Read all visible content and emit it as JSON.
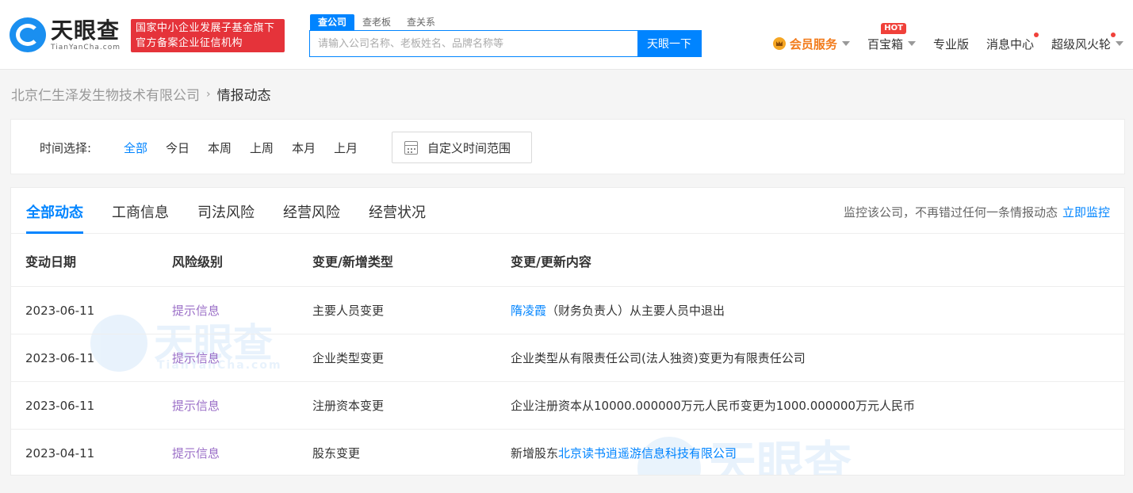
{
  "header": {
    "logo_text": "天眼查",
    "logo_sub": "TianYanCha.com",
    "badge_line1": "国家中小企业发展子基金旗下",
    "badge_line2": "官方备案企业征信机构",
    "search_tabs": [
      "查公司",
      "查老板",
      "查关系"
    ],
    "search_placeholder": "请输入公司名称、老板姓名、品牌名称等",
    "search_button": "天眼一下",
    "nav": {
      "vip": "会员服务",
      "treasure": "百宝箱",
      "hot": "HOT",
      "pro": "专业版",
      "messages": "消息中心",
      "fire": "超级风火轮"
    }
  },
  "breadcrumb": {
    "company": "北京仁生泽发生物技术有限公司",
    "sep": "›",
    "current": "情报动态"
  },
  "filter": {
    "label": "时间选择:",
    "options": [
      "全部",
      "今日",
      "本周",
      "上周",
      "本月",
      "上月"
    ],
    "custom": "自定义时间范围"
  },
  "tabs": [
    "全部动态",
    "工商信息",
    "司法风险",
    "经营风险",
    "经营状况"
  ],
  "monitor": {
    "text": "监控该公司，不再错过任何一条情报动态",
    "link": "立即监控"
  },
  "table": {
    "headers": [
      "变动日期",
      "风险级别",
      "变更/新增类型",
      "变更/更新内容"
    ],
    "rows": [
      {
        "date": "2023-06-11",
        "risk": "提示信息",
        "type": "主要人员变更",
        "link": "隋凌霞",
        "content": "（财务负责人）从主要人员中退出"
      },
      {
        "date": "2023-06-11",
        "risk": "提示信息",
        "type": "企业类型变更",
        "prefix": "",
        "content": "企业类型从有限责任公司(法人独资)变更为有限责任公司"
      },
      {
        "date": "2023-06-11",
        "risk": "提示信息",
        "type": "注册资本变更",
        "content": "企业注册资本从10000.000000万元人民币变更为1000.000000万元人民币"
      },
      {
        "date": "2023-04-11",
        "risk": "提示信息",
        "type": "股东变更",
        "prefix": "新增股东",
        "link": "北京读书逍遥游信息科技有限公司"
      }
    ]
  },
  "watermark": {
    "text": "天眼查",
    "sub": "TianYanCha.com"
  }
}
